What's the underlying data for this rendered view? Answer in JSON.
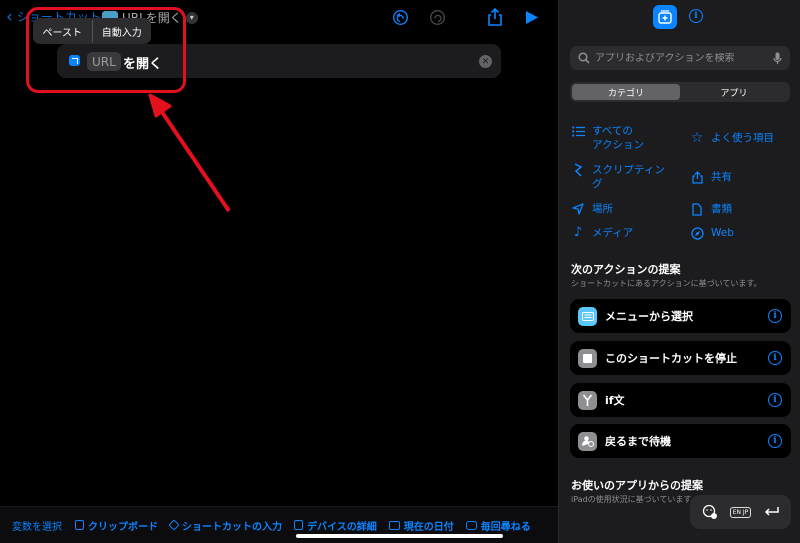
{
  "editor": {
    "back_label": "ショートカット",
    "title": "URLを開く",
    "edit_menu": {
      "paste": "ペースト",
      "autofill": "自動入力"
    },
    "action": {
      "token": "URL",
      "label": "を開く"
    }
  },
  "bottom_bar": {
    "select_variable": "変数を選択",
    "chips": [
      "クリップボード",
      "ショートカットの入力",
      "デバイスの詳細",
      "現在の日付",
      "毎回尋ねる"
    ]
  },
  "sidebar": {
    "search_placeholder": "アプリおよびアクションを検索",
    "segments": {
      "categories": "カテゴリ",
      "apps": "アプリ"
    },
    "categories": {
      "all_actions": "すべての\nアクション",
      "favorites": "よく使う項目",
      "scripting": "スクリプティング",
      "sharing": "共有",
      "location": "場所",
      "documents": "書類",
      "media": "メディア",
      "web": "Web"
    },
    "next_actions": {
      "title": "次のアクションの提案",
      "subtitle": "ショートカットにあるアクションに基づいています。",
      "items": [
        "メニューから選択",
        "このショートカットを停止",
        "if文",
        "戻るまで待機"
      ]
    },
    "app_suggestions": {
      "title": "お使いのアプリからの提案",
      "subtitle": "iPadの使用状況に基づいています。"
    },
    "keyboard_bar": {
      "language": "EN JP"
    }
  },
  "colors": {
    "accent": "#0a84ff",
    "highlight": "#e3101d",
    "menu_icon": "#5ac8fa",
    "stop_icon": "#8e8e93"
  }
}
